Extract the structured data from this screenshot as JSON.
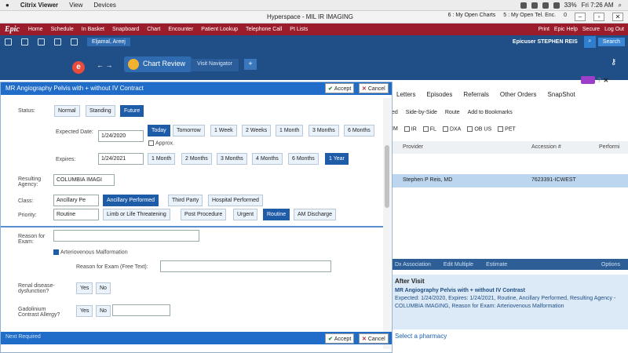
{
  "macbar": {
    "apple": "",
    "app": "Citrix Viewer",
    "menus": [
      "View",
      "Devices"
    ],
    "battery": "33%",
    "clock": "Fri 7:26 AM"
  },
  "window": {
    "title": "Hyperspace - MIL IR IMAGING",
    "tabs": [
      "6 : My Open Charts",
      "5 : My Open Tel. Enc.",
      "0"
    ]
  },
  "epic": {
    "logo": "Epic",
    "items": [
      "Home",
      "Schedule",
      "In Basket",
      "Snapboard",
      "Chart",
      "Encounter",
      "Patient Lookup",
      "Telephone Call",
      "Pt Lists"
    ],
    "right": [
      "Print",
      "Epic Help",
      "Secure",
      "Log Out"
    ]
  },
  "toolbar2": {
    "patient": "Eljamal, Areej",
    "epicuser": "Epicuser",
    "provider": "STEPHEN REIS",
    "search": "Search"
  },
  "header": {
    "chart_review": "Chart Review",
    "visit_navigator": "Visit Navigator",
    "add": "+"
  },
  "dialog": {
    "title": "MR Angiography Pelvis with + without IV Contract",
    "accept": "Accept",
    "cancel": "Cancel",
    "status_label": "Status:",
    "status_opts": [
      "Normal",
      "Standing",
      "Future"
    ],
    "expected_label": "Expected Date:",
    "expected_value": "1/24/2020",
    "expected_opts": [
      "Today",
      "Tomorrow",
      "1 Week",
      "2 Weeks",
      "1 Month",
      "3 Months",
      "6 Months"
    ],
    "approx": "Approx.",
    "expires_label": "Expires:",
    "expires_value": "1/24/2021",
    "expires_opts": [
      "1 Month",
      "2 Months",
      "3 Months",
      "4 Months",
      "6 Months",
      "1 Year"
    ],
    "resulting_label": "Resulting Agency:",
    "resulting_value": "COLUMBIA IMAGI",
    "class_label": "Class:",
    "class_value": "Ancillary Pe",
    "class_opts": [
      "Ancillary Performed",
      "Third Party",
      "Hospital Performed"
    ],
    "priority_label": "Priority:",
    "priority_value": "Routine",
    "priority_opts": [
      "Limb or Life Threatening",
      "Post Procedure",
      "Urgent",
      "Routine",
      "AM Discharge"
    ],
    "reason_label": "Reason for Exam:",
    "avm": "Arteriovenous Malformation",
    "reason_free_label": "Reason for Exam (Free Text):",
    "renal_label": "Renal disease-dysfunction?",
    "yes": "Yes",
    "no": "No",
    "gad_label": "Gadolinium Contrast Allergy?",
    "next_required": "Next Required"
  },
  "right": {
    "tabs": [
      "Letters",
      "Episodes",
      "Referrals",
      "Other Orders",
      "SnapShot"
    ],
    "tools": [
      "ed",
      "Side-by-Side",
      "Route",
      "Add to Bookmarks"
    ],
    "filters": [
      "IM",
      "IR",
      "FL",
      "DXA",
      "OB US",
      "PET"
    ],
    "cols": [
      "Provider",
      "Accession #",
      "Performi"
    ],
    "row_provider": "Stephen P Reis, MD",
    "row_accession": "7623391-ICWEST",
    "bottom": [
      "Dx Association",
      "Edit Multiple",
      "Estimate",
      "Options"
    ],
    "after_visit": "After Visit",
    "order_title": "MR Angiography Pelvis with + without IV Contrast",
    "order_detail": "Expected: 1/24/2020, Expires: 1/24/2021, Routine, Ancillary Performed, Resulting Agency - COLUMBIA IMAGING, Reason for Exam: Arteriovenous Malformation",
    "select_pharmacy": "Select a pharmacy"
  },
  "colors": {
    "epic_red": "#9b1c2a",
    "nav_blue": "#1f4f86",
    "dialog_blue": "#1f6cc9",
    "selected": "#1f5ca8"
  }
}
